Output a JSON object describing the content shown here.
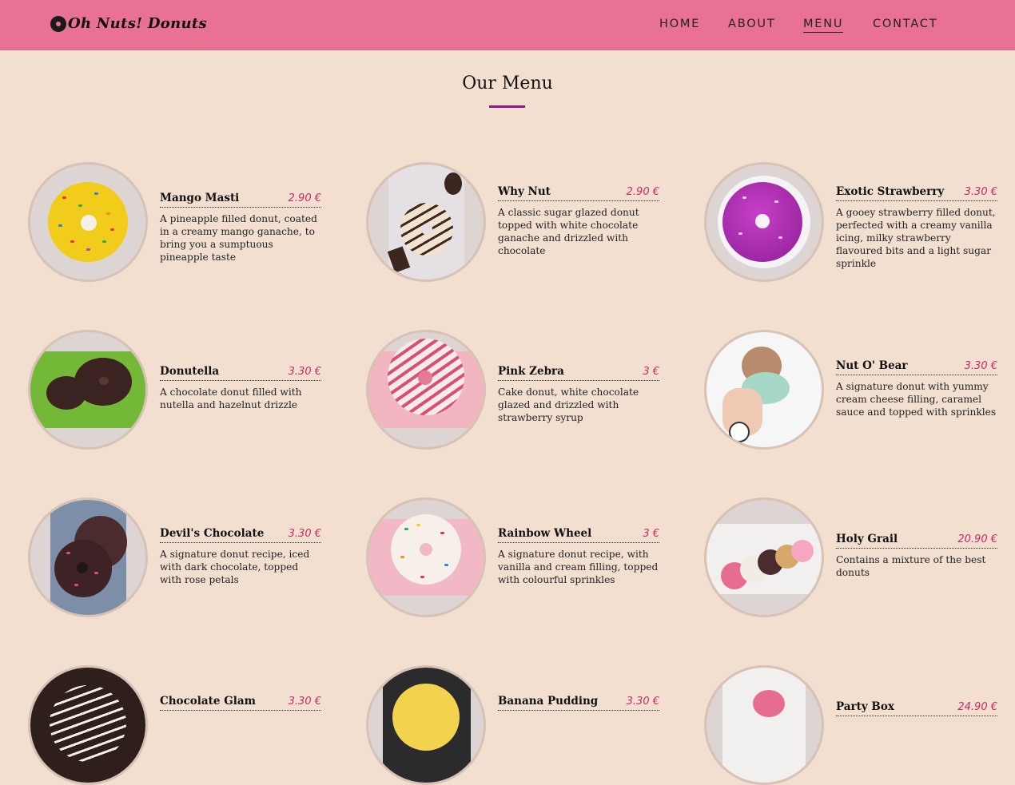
{
  "brand": {
    "name": "Oh Nuts! Donuts",
    "icon": "donut-logo-icon"
  },
  "nav": [
    {
      "label": "HOME",
      "active": false
    },
    {
      "label": "ABOUT",
      "active": false
    },
    {
      "label": "MENU",
      "active": true
    },
    {
      "label": "CONTACT",
      "active": false
    }
  ],
  "page": {
    "title": "Our Menu",
    "accent": "#8b1a89"
  },
  "colors": {
    "header": "#e87194",
    "background": "#f2dfd0",
    "price": "#c42d66"
  },
  "menu": [
    {
      "name": "Mango Masti",
      "price": "2.90 €",
      "description": "A pineapple filled donut, coated in a creamy mango ganache, to bring you a sumptuous pineapple taste",
      "image": "yellow-sprinkle-donut"
    },
    {
      "name": "Why Nut",
      "price": "2.90 €",
      "description": "A classic sugar glazed donut topped with white chocolate ganache and drizzled with chocolate",
      "image": "chocolate-drizzle-donut"
    },
    {
      "name": "Exotic Strawberry",
      "price": "3.30 €",
      "description": "A gooey strawberry filled donut, perfected with a creamy vanilla icing, milky strawberry flavoured bits and a light sugar sprinkle",
      "image": "purple-glazed-donut"
    },
    {
      "name": "Donutella",
      "price": "3.30 €",
      "description": "A chocolate donut filled with nutella and hazelnut drizzle",
      "image": "chocolate-donuts-on-lettuce"
    },
    {
      "name": "Pink Zebra",
      "price": "3 €",
      "description": "Cake donut, white chocolate glazed and drizzled with strawberry syrup",
      "image": "pink-striped-donut"
    },
    {
      "name": "Nut O' Bear",
      "price": "3.30 €",
      "description": "A signature donut with yummy cream cheese filling, caramel sauce and topped with sprinkles",
      "image": "bear-donut-in-hand"
    },
    {
      "name": "Devil's Chocolate",
      "price": "3.30 €",
      "description": "A signature donut recipe, iced with dark chocolate, topped with rose petals",
      "image": "dark-chocolate-donuts"
    },
    {
      "name": "Rainbow Wheel",
      "price": "3 €",
      "description": "A signature donut recipe, with vanilla and cream filling, topped with colourful sprinkles",
      "image": "rainbow-sprinkle-donut"
    },
    {
      "name": "Holy Grail",
      "price": "20.90 €",
      "description": "Contains a mixture of the best donuts",
      "image": "donut-box"
    },
    {
      "name": "Chocolate Glam",
      "price": "3.30 €",
      "description": "",
      "image": "zebra-chocolate-donut"
    },
    {
      "name": "Banana Pudding",
      "price": "3.30 €",
      "description": "",
      "image": "banana-pudding-donut"
    },
    {
      "name": "Party Box",
      "price": "24.90 €",
      "description": "",
      "image": "party-donut-box"
    }
  ]
}
